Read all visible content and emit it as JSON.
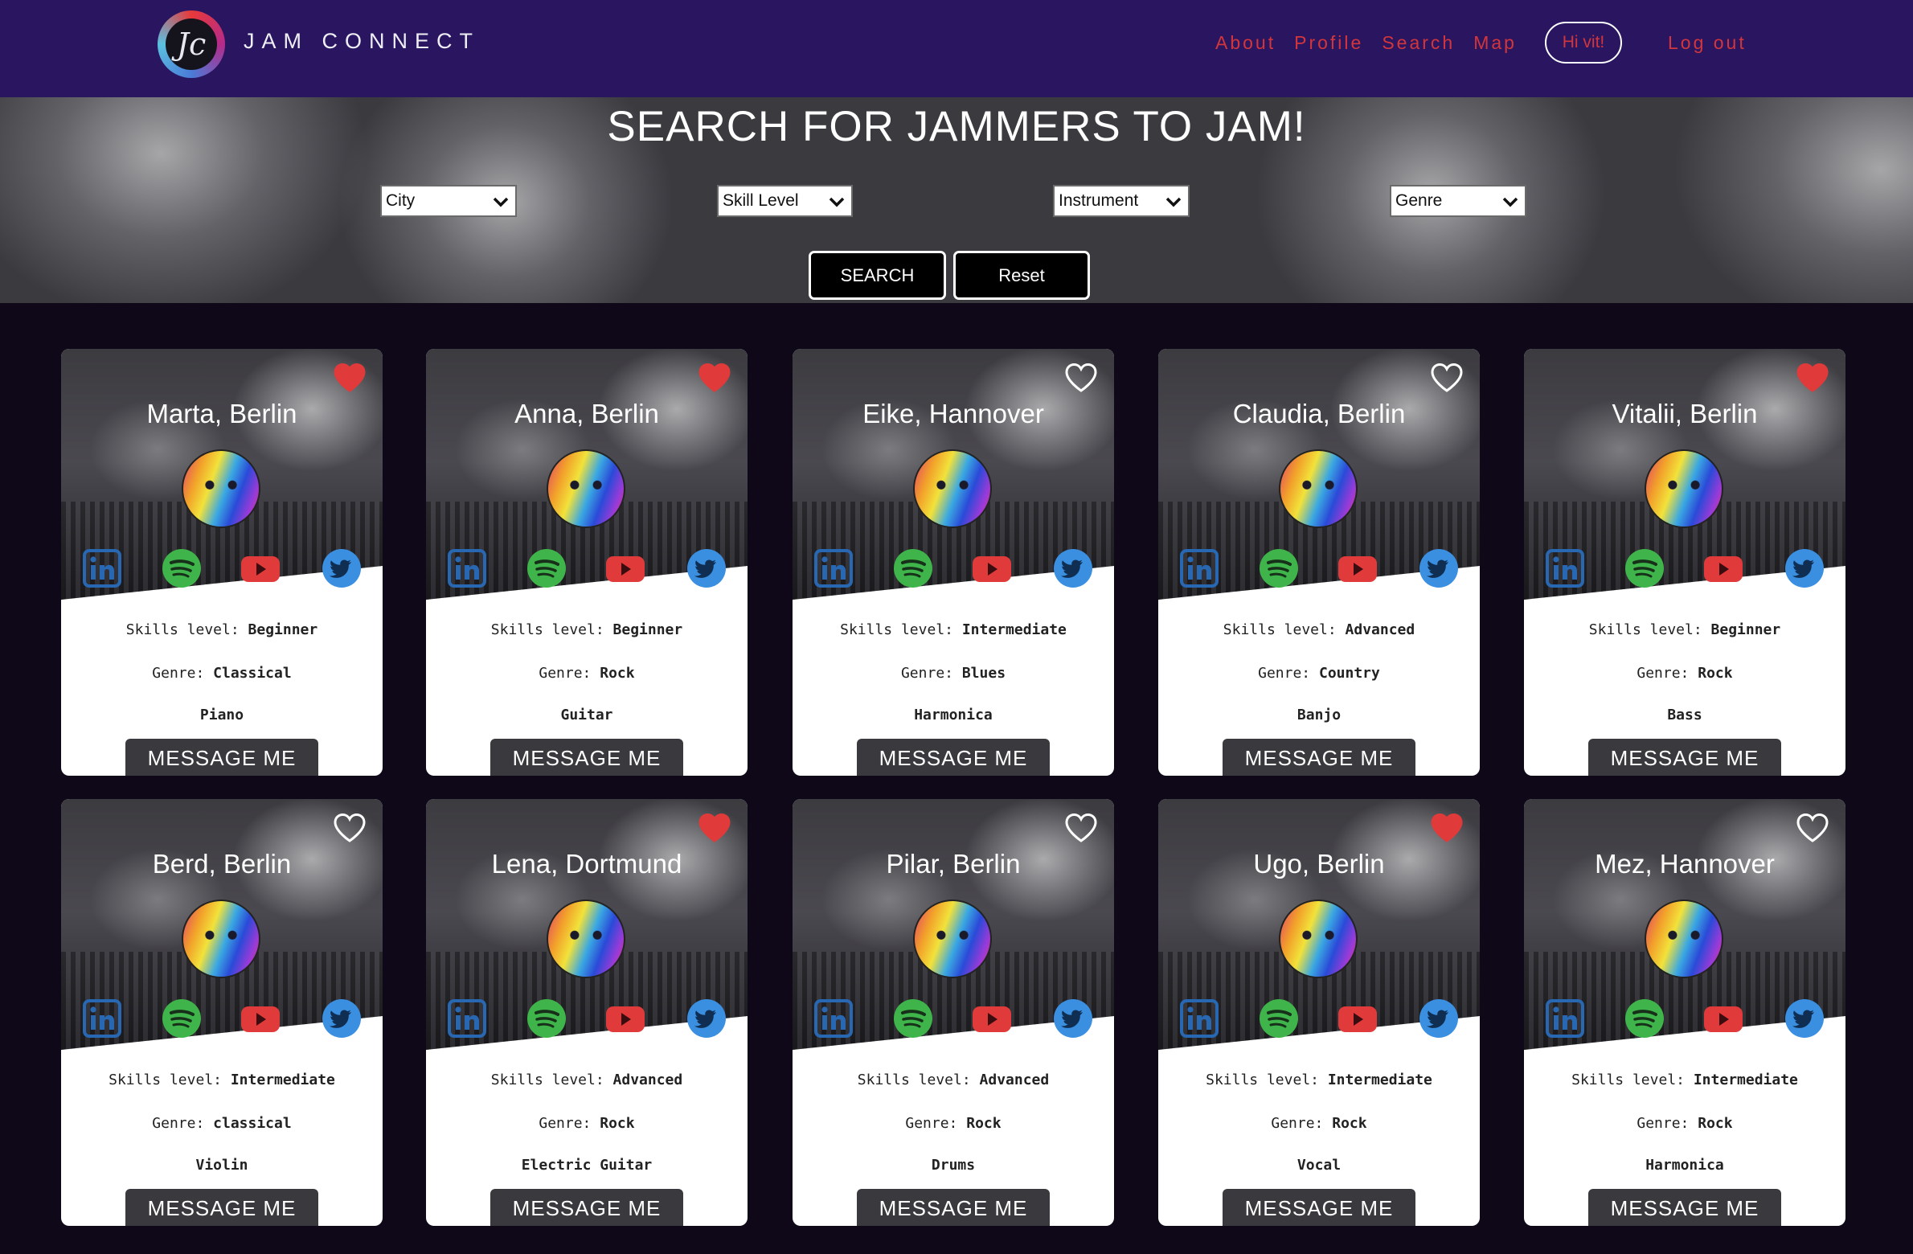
{
  "nav": {
    "logo_mark": "Jc",
    "brand": "JAM CONNECT",
    "links": [
      "About",
      "Profile",
      "Search",
      "Map"
    ],
    "greeting": "Hi vit!",
    "logout": "Log out"
  },
  "hero": {
    "title": "SEARCH FOR JAMMERS TO JAM!",
    "filters": [
      "City",
      "Skill Level",
      "Instrument",
      "Genre"
    ],
    "search_label": "SEARCH",
    "reset_label": "Reset"
  },
  "labels": {
    "skills": "Skills level:",
    "genre": "Genre:",
    "message": "MESSAGE ME"
  },
  "colors": {
    "nav_bg": "#2a1660",
    "page_bg": "#0e0818",
    "accent_red": "#d2363c",
    "heart_red": "#e03a3a",
    "linkedin": "#2867b2",
    "spotify": "#3fb44a",
    "youtube": "#e03a3a",
    "twitter": "#3b8fe0"
  },
  "social_icons": [
    "linkedin-icon",
    "spotify-icon",
    "youtube-icon",
    "twitter-icon"
  ],
  "cards": [
    {
      "name": "Marta, Berlin",
      "skill": "Beginner",
      "genre": "Classical",
      "instrument": "Piano",
      "favorite": true
    },
    {
      "name": "Anna, Berlin",
      "skill": "Beginner",
      "genre": "Rock",
      "instrument": "Guitar",
      "favorite": true
    },
    {
      "name": "Eike, Hannover",
      "skill": "Intermediate",
      "genre": "Blues",
      "instrument": "Harmonica",
      "favorite": false
    },
    {
      "name": "Claudia, Berlin",
      "skill": "Advanced",
      "genre": "Country",
      "instrument": "Banjo",
      "favorite": false
    },
    {
      "name": "Vitalii, Berlin",
      "skill": "Beginner",
      "genre": "Rock",
      "instrument": "Bass",
      "favorite": true
    },
    {
      "name": "Berd, Berlin",
      "skill": "Intermediate",
      "genre": "classical",
      "instrument": "Violin",
      "favorite": false
    },
    {
      "name": "Lena, Dortmund",
      "skill": "Advanced",
      "genre": "Rock",
      "instrument": "Electric Guitar",
      "favorite": true
    },
    {
      "name": "Pilar, Berlin",
      "skill": "Advanced",
      "genre": "Rock",
      "instrument": "Drums",
      "favorite": false
    },
    {
      "name": "Ugo, Berlin",
      "skill": "Intermediate",
      "genre": "Rock",
      "instrument": "Vocal",
      "favorite": true
    },
    {
      "name": "Mez, Hannover",
      "skill": "Intermediate",
      "genre": "Rock",
      "instrument": "Harmonica",
      "favorite": false
    }
  ]
}
